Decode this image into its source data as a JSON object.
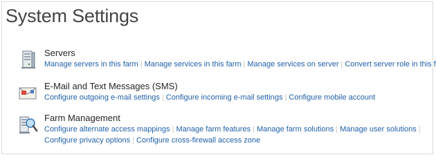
{
  "page_title": "System Settings",
  "colors": {
    "title": "#444444",
    "heading": "#262626",
    "link": "#1f5fa8",
    "separator": "#c7c7c7",
    "border": "#d9d9d9"
  },
  "separator": "|",
  "sections": [
    {
      "title": "Servers",
      "icon": "server-icon",
      "links": [
        "Manage servers in this farm",
        "Manage services in this farm",
        "Manage services on server",
        "Convert server role in this farm"
      ]
    },
    {
      "title": "E-Mail and Text Messages (SMS)",
      "icon": "email-icon",
      "links": [
        "Configure outgoing e-mail settings",
        "Configure incoming e-mail settings",
        "Configure mobile account"
      ]
    },
    {
      "title": "Farm Management",
      "icon": "farm-management-icon",
      "links": [
        "Configure alternate access mappings",
        "Manage farm features",
        "Manage farm solutions",
        "Manage user solutions",
        "Configure privacy options",
        "Configure cross-firewall access zone"
      ]
    }
  ]
}
